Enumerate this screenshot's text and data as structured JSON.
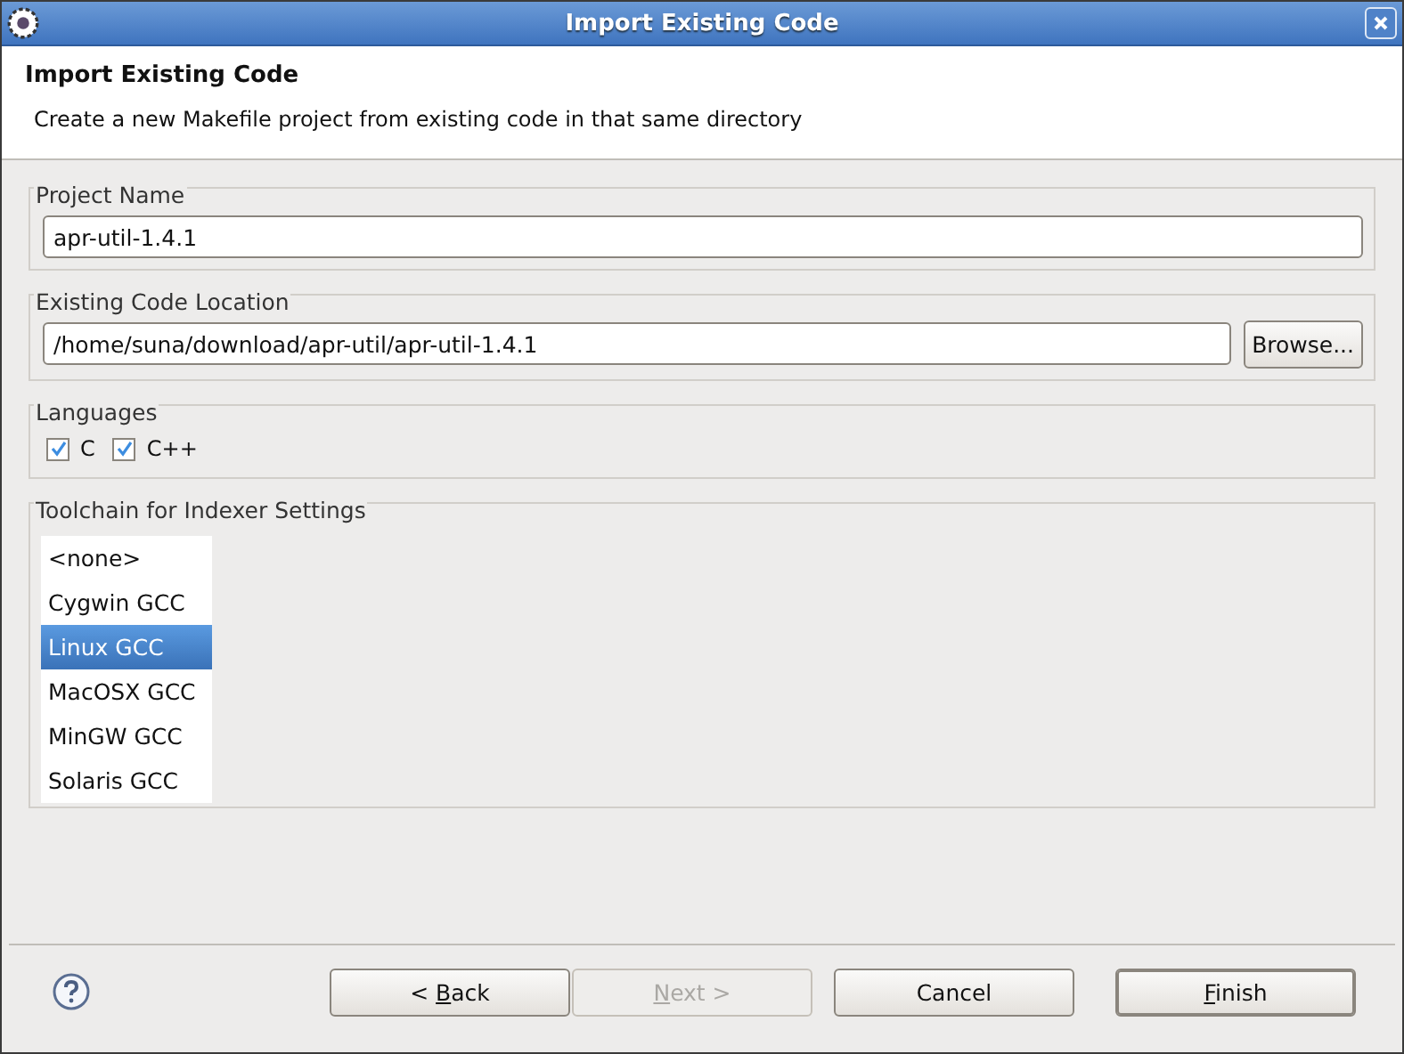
{
  "window": {
    "title": "Import Existing Code"
  },
  "header": {
    "title": "Import Existing Code",
    "description": "Create a new Makefile project from existing code in that same directory"
  },
  "project_name": {
    "legend": "Project Name",
    "value": "apr-util-1.4.1"
  },
  "location": {
    "legend": "Existing Code Location",
    "value": "/home/suna/download/apr-util/apr-util-1.4.1",
    "button": "Browse..."
  },
  "languages": {
    "legend": "Languages",
    "items": [
      {
        "label": "C",
        "checked": true
      },
      {
        "label": "C++",
        "checked": true
      }
    ]
  },
  "toolchain": {
    "legend": "Toolchain for Indexer Settings",
    "items": [
      {
        "label": "<none>",
        "selected": false
      },
      {
        "label": "Cygwin GCC",
        "selected": false
      },
      {
        "label": "Linux GCC",
        "selected": true
      },
      {
        "label": "MacOSX GCC",
        "selected": false
      },
      {
        "label": "MinGW GCC",
        "selected": false
      },
      {
        "label": "Solaris GCC",
        "selected": false
      }
    ]
  },
  "buttons": [
    {
      "before": "< ",
      "mnemonic": "B",
      "after": "ack",
      "disabled": false,
      "default": false
    },
    {
      "mnemonic": "N",
      "after": "ext >",
      "disabled": true,
      "default": false
    },
    {
      "before": "Cancel",
      "disabled": false,
      "default": false
    },
    {
      "mnemonic": "F",
      "after": "inish",
      "disabled": false,
      "default": true
    }
  ]
}
